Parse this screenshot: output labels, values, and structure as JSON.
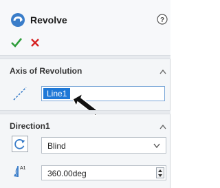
{
  "feature": {
    "title": "Revolve",
    "title_icon": "revolve-feature-icon",
    "help_icon": "help-question-icon",
    "ok_icon": "checkmark-icon",
    "cancel_icon": "close-x-icon"
  },
  "axis_section": {
    "title": "Axis of Revolution",
    "icon": "axis-line-icon",
    "value": "Line1",
    "collapse_icon": "chevron-up-icon"
  },
  "direction_section": {
    "title": "Direction1",
    "reverse_icon": "reverse-direction-icon",
    "end_condition": "Blind",
    "dropdown_icon": "chevron-down-icon",
    "angle_icon": "angle-icon",
    "angle_label": "A1",
    "angle_value": "360.00deg",
    "spinner_icon": "spinner-icon",
    "collapse_icon": "chevron-up-icon"
  },
  "colors": {
    "ok_green": "#2e9d3a",
    "cancel_red": "#d62222",
    "selection_blue": "#1e78d7",
    "accent_blue": "#3a7dc9"
  }
}
